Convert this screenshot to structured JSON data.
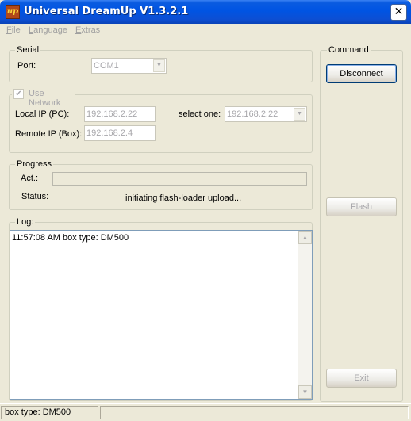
{
  "window": {
    "title": "Universal DreamUp V1.3.2.1",
    "icon_text": "up",
    "close_label": "✕"
  },
  "menu": [
    {
      "label": "File"
    },
    {
      "label": "Language"
    },
    {
      "label": "Extras"
    }
  ],
  "serial": {
    "group_label": "Serial",
    "port_label": "Port:",
    "port_value": "COM1"
  },
  "network": {
    "checkbox_label": "Use Network",
    "checked": true,
    "local_ip_label": "Local IP (PC):",
    "local_ip_value": "192.168.2.22",
    "select_label": "select one:",
    "select_value": "192.168.2.22",
    "remote_ip_label": "Remote IP (Box):",
    "remote_ip_value": "192.168.2.4"
  },
  "progress": {
    "group_label": "Progress",
    "act_label": "Act.:",
    "act_value": 0,
    "status_label": "Status:",
    "status_value": "initiating flash-loader upload..."
  },
  "log": {
    "group_label": "Log:",
    "lines": [
      "11:57:08 AM box type: DM500"
    ]
  },
  "command": {
    "group_label": "Command",
    "disconnect_label": "Disconnect",
    "flash_label": "Flash",
    "exit_label": "Exit"
  },
  "statusbar": {
    "pane1": "box type: DM500",
    "pane2": ""
  }
}
